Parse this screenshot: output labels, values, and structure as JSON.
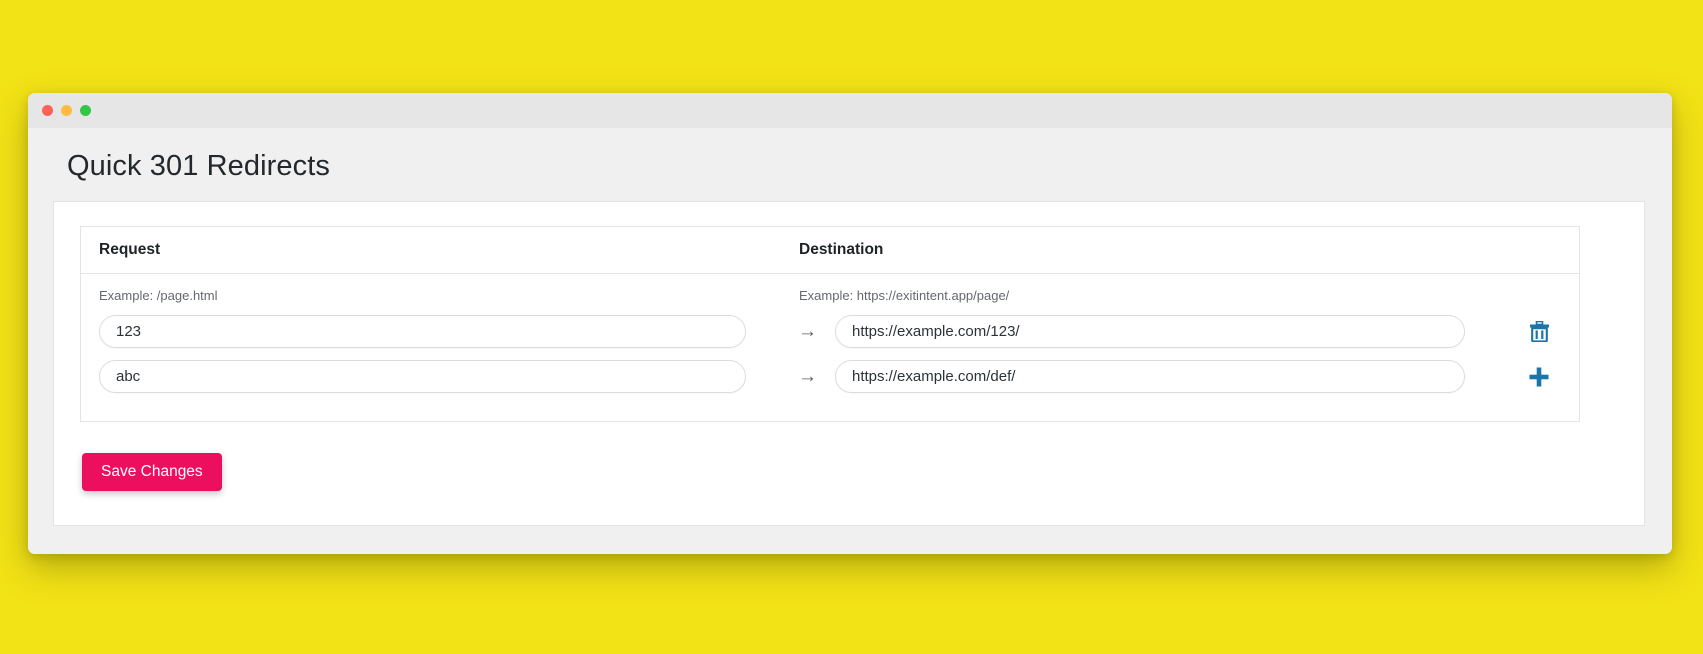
{
  "window": {
    "controls": [
      {
        "name": "close",
        "color": "#fd6158"
      },
      {
        "name": "minimize",
        "color": "#fdbc40"
      },
      {
        "name": "maximize",
        "color": "#33c748"
      }
    ]
  },
  "page": {
    "title": "Quick 301 Redirects",
    "background_color": "#f2e316"
  },
  "table": {
    "headers": {
      "request": "Request",
      "destination": "Destination"
    },
    "examples": {
      "request": "Example: /page.html",
      "destination": "Example: https://exitintent.app/page/"
    },
    "arrow_glyph": "→",
    "rows": [
      {
        "request_value": "123",
        "request_placeholder": "",
        "destination_value": "https://example.com/123/",
        "destination_placeholder": "",
        "action": "delete",
        "action_label": "Delete redirect",
        "action_color": "#1b75a8"
      },
      {
        "request_value": "abc",
        "request_placeholder": "",
        "destination_value": "https://example.com/def/",
        "destination_placeholder": "",
        "action": "add",
        "action_label": "Add redirect",
        "action_color": "#1b75a8"
      }
    ]
  },
  "actions": {
    "save_label": "Save Changes",
    "save_color": "#ec0f5e"
  }
}
